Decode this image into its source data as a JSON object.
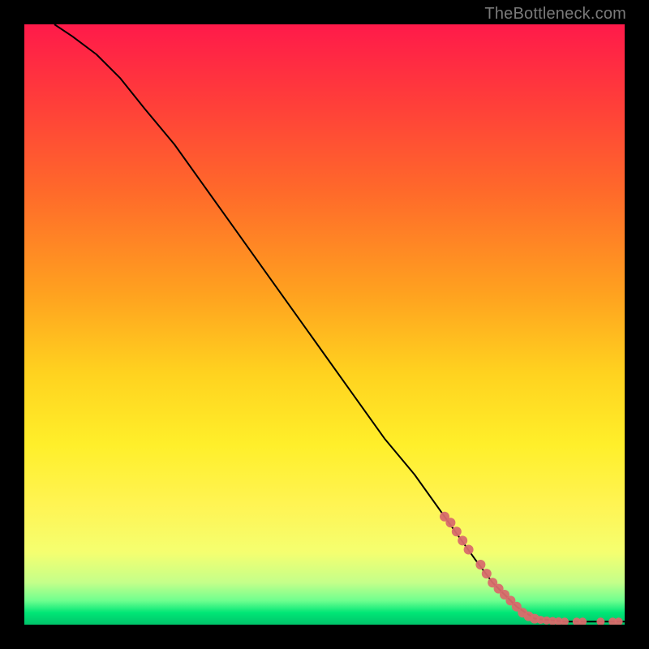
{
  "watermark": "TheBottleneck.com",
  "chart_data": {
    "type": "line",
    "title": "",
    "xlabel": "",
    "ylabel": "",
    "xlim": [
      0,
      100
    ],
    "ylim": [
      0,
      100
    ],
    "series": [
      {
        "name": "curve",
        "x": [
          5,
          8,
          12,
          16,
          20,
          25,
          30,
          35,
          40,
          45,
          50,
          55,
          60,
          65,
          70,
          75,
          78,
          80,
          82,
          85,
          90,
          95,
          100
        ],
        "y": [
          100,
          98,
          95,
          91,
          86,
          80,
          73,
          66,
          59,
          52,
          45,
          38,
          31,
          25,
          18,
          11,
          7,
          5,
          3,
          1,
          0.5,
          0.5,
          0.5
        ]
      }
    ],
    "markers": {
      "name": "highlighted-points",
      "color": "#d86b6b",
      "points": [
        {
          "x": 70,
          "y": 18,
          "r": 6
        },
        {
          "x": 71,
          "y": 17,
          "r": 6
        },
        {
          "x": 72,
          "y": 15.5,
          "r": 6
        },
        {
          "x": 73,
          "y": 14,
          "r": 6
        },
        {
          "x": 74,
          "y": 12.5,
          "r": 6
        },
        {
          "x": 76,
          "y": 10,
          "r": 6
        },
        {
          "x": 77,
          "y": 8.5,
          "r": 6
        },
        {
          "x": 78,
          "y": 7,
          "r": 6
        },
        {
          "x": 79,
          "y": 6,
          "r": 6
        },
        {
          "x": 80,
          "y": 5,
          "r": 6
        },
        {
          "x": 81,
          "y": 4,
          "r": 6
        },
        {
          "x": 82,
          "y": 3,
          "r": 6
        },
        {
          "x": 83,
          "y": 2,
          "r": 6
        },
        {
          "x": 84,
          "y": 1.4,
          "r": 6
        },
        {
          "x": 85,
          "y": 1,
          "r": 6
        },
        {
          "x": 86,
          "y": 0.8,
          "r": 5
        },
        {
          "x": 87,
          "y": 0.7,
          "r": 5
        },
        {
          "x": 88,
          "y": 0.6,
          "r": 5
        },
        {
          "x": 89,
          "y": 0.55,
          "r": 5
        },
        {
          "x": 90,
          "y": 0.5,
          "r": 5
        },
        {
          "x": 92,
          "y": 0.5,
          "r": 5
        },
        {
          "x": 93,
          "y": 0.5,
          "r": 5
        },
        {
          "x": 96,
          "y": 0.5,
          "r": 5
        },
        {
          "x": 98,
          "y": 0.5,
          "r": 5
        },
        {
          "x": 99,
          "y": 0.5,
          "r": 5
        }
      ]
    }
  }
}
